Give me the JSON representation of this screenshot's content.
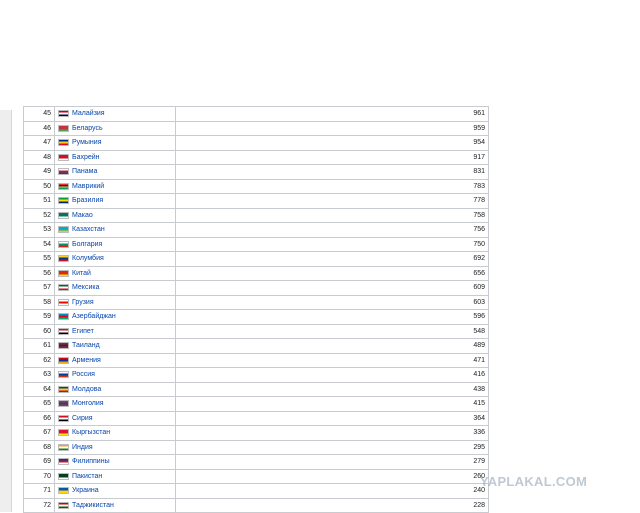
{
  "rows": [
    {
      "rank": "45",
      "country": "Малайзия",
      "value": "961",
      "flag": [
        "#cc0001",
        "#ffffff",
        "#010066"
      ]
    },
    {
      "rank": "46",
      "country": "Беларусь",
      "value": "959",
      "flag": [
        "#c8313e",
        "#c8313e",
        "#4aa657"
      ]
    },
    {
      "rank": "47",
      "country": "Румыния",
      "value": "954",
      "flag": [
        "#002b7f",
        "#fcd116",
        "#ce1126"
      ]
    },
    {
      "rank": "48",
      "country": "Бахрейн",
      "value": "917",
      "flag": [
        "#ce1126",
        "#ce1126",
        "#ffffff"
      ]
    },
    {
      "rank": "49",
      "country": "Панама",
      "value": "831",
      "flag": [
        "#ffffff",
        "#d21034",
        "#005293"
      ]
    },
    {
      "rank": "50",
      "country": "Маврикий",
      "value": "783",
      "flag": [
        "#ea2839",
        "#1a206d",
        "#ffd500",
        "#00a551"
      ]
    },
    {
      "rank": "51",
      "country": "Бразилия",
      "value": "778",
      "flag": [
        "#009c3b",
        "#ffdf00",
        "#002776"
      ]
    },
    {
      "rank": "52",
      "country": "Макао",
      "value": "758",
      "flag": [
        "#00785e",
        "#00785e",
        "#ffffff"
      ]
    },
    {
      "rank": "53",
      "country": "Казахстан",
      "value": "756",
      "flag": [
        "#00afca",
        "#00afca",
        "#fec50c"
      ]
    },
    {
      "rank": "54",
      "country": "Болгария",
      "value": "750",
      "flag": [
        "#ffffff",
        "#00966e",
        "#d62612"
      ]
    },
    {
      "rank": "55",
      "country": "Колумбия",
      "value": "692",
      "flag": [
        "#fcd116",
        "#003893",
        "#ce1126"
      ]
    },
    {
      "rank": "56",
      "country": "Китай",
      "value": "656",
      "flag": [
        "#de2910",
        "#de2910",
        "#ffde00"
      ]
    },
    {
      "rank": "57",
      "country": "Мексика",
      "value": "609",
      "flag": [
        "#006847",
        "#ffffff",
        "#ce1126"
      ]
    },
    {
      "rank": "58",
      "country": "Грузия",
      "value": "603",
      "flag": [
        "#ffffff",
        "#ff0000",
        "#ffffff"
      ]
    },
    {
      "rank": "59",
      "country": "Азербайджан",
      "value": "596",
      "flag": [
        "#0092bc",
        "#e4002b",
        "#00af66"
      ]
    },
    {
      "rank": "60",
      "country": "Египет",
      "value": "548",
      "flag": [
        "#ce1126",
        "#ffffff",
        "#000000"
      ]
    },
    {
      "rank": "61",
      "country": "Таиланд",
      "value": "489",
      "flag": [
        "#a51931",
        "#2d2a4a",
        "#a51931"
      ]
    },
    {
      "rank": "62",
      "country": "Армения",
      "value": "471",
      "flag": [
        "#d90012",
        "#0033a0",
        "#f2a800"
      ]
    },
    {
      "rank": "63",
      "country": "Россия",
      "value": "416",
      "flag": [
        "#ffffff",
        "#0039a6",
        "#d52b1e"
      ]
    },
    {
      "rank": "64",
      "country": "Молдова",
      "value": "438",
      "flag": [
        "#003da5",
        "#ffd200",
        "#cc092f"
      ]
    },
    {
      "rank": "65",
      "country": "Монголия",
      "value": "415",
      "flag": [
        "#c4272f",
        "#015197",
        "#c4272f"
      ]
    },
    {
      "rank": "66",
      "country": "Сирия",
      "value": "364",
      "flag": [
        "#ce1126",
        "#ffffff",
        "#000000"
      ]
    },
    {
      "rank": "67",
      "country": "Кыргызстан",
      "value": "336",
      "flag": [
        "#e8112d",
        "#e8112d",
        "#ffef00"
      ]
    },
    {
      "rank": "68",
      "country": "Индия",
      "value": "295",
      "flag": [
        "#ff9933",
        "#ffffff",
        "#138808"
      ]
    },
    {
      "rank": "69",
      "country": "Филиппины",
      "value": "279",
      "flag": [
        "#0038a8",
        "#ce1126",
        "#ffffff"
      ]
    },
    {
      "rank": "70",
      "country": "Пакистан",
      "value": "260",
      "flag": [
        "#01411c",
        "#01411c",
        "#ffffff"
      ]
    },
    {
      "rank": "71",
      "country": "Украина",
      "value": "240",
      "flag": [
        "#0057b7",
        "#ffd700"
      ]
    },
    {
      "rank": "72",
      "country": "Таджикистан",
      "value": "228",
      "flag": [
        "#cc0000",
        "#ffffff",
        "#006600"
      ]
    }
  ],
  "watermark": "YAPLAKAL.COM"
}
